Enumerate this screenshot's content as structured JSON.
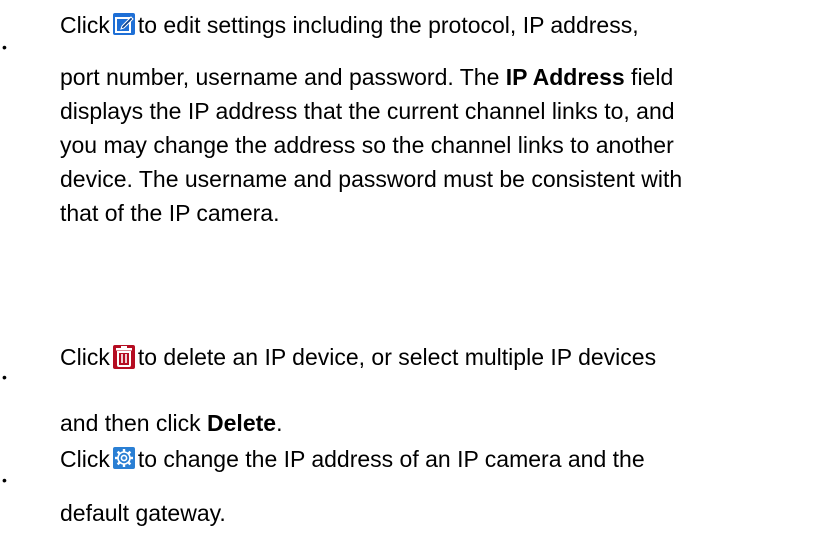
{
  "items": [
    {
      "bullet": "•",
      "line1_before": "Click",
      "icon": "edit-icon",
      "line1_after": "to edit settings including the protocol, IP address,",
      "line2_before": "port number, username and password. The ",
      "line2_bold": "IP Address",
      "line2_after": " field",
      "line3": "displays the IP address that the current channel links to, and",
      "line4": "you may change the address so the channel links to another",
      "line5": "device. The username and password must be consistent with",
      "line6": "that of the IP camera."
    },
    {
      "bullet": "•",
      "line1_before": "Click",
      "icon": "delete-icon",
      "line1_after": "to delete an IP device, or select multiple IP devices",
      "line2_before": "and then click ",
      "line2_bold": "Delete",
      "line2_after": "."
    },
    {
      "bullet": "•",
      "line1_before": "Click",
      "icon": "gear-icon",
      "line1_after": "to change the IP address of an IP camera and the",
      "line2": "default gateway."
    }
  ],
  "colors": {
    "edit_icon": "#1e6fd6",
    "delete_icon": "#d8102a",
    "gear_icon": "#2a7fd4"
  }
}
